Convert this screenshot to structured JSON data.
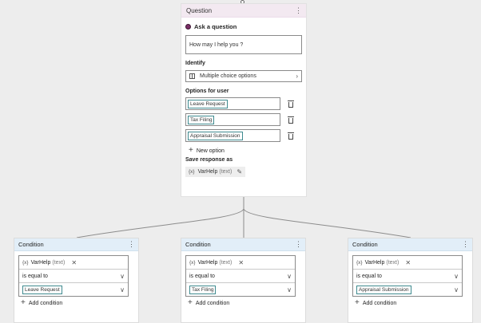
{
  "question": {
    "header_title": "Question",
    "menu_glyph": "⋮",
    "ask_label": "Ask a question",
    "question_text": "How may I help you ?",
    "identify_label": "Identify",
    "identify_value": "Multiple choice options",
    "options_label": "Options for user",
    "options": [
      "Leave Request",
      "Tax Filing",
      "Appraisal Submission"
    ],
    "new_option_label": "New option",
    "save_label": "Save response as",
    "variable": {
      "prefix": "{x}",
      "name": "VarHelp",
      "type": "(text)"
    }
  },
  "conditions": [
    {
      "title": "Condition",
      "variable": {
        "prefix": "{x}",
        "name": "VarHelp",
        "type": "(text)"
      },
      "operator": "is equal to",
      "value": "Leave Request",
      "add_label": "Add condition"
    },
    {
      "title": "Condition",
      "variable": {
        "prefix": "{x}",
        "name": "VarHelp",
        "type": "(text)"
      },
      "operator": "is equal to",
      "value": "Tax Filing",
      "add_label": "Add condition"
    },
    {
      "title": "Condition",
      "variable": {
        "prefix": "{x}",
        "name": "VarHelp",
        "type": "(text)"
      },
      "operator": "is equal to",
      "value": "Appraisal Submission",
      "add_label": "Add condition"
    }
  ],
  "colors": {
    "question_header": "#f3e9f1",
    "condition_header": "#e2eef8",
    "tag_border": "#3f8a8f",
    "canvas": "#ededed"
  },
  "icons": [
    "more-icon",
    "radio-icon",
    "list-icon",
    "chevron-right-icon",
    "delete-icon",
    "add-icon",
    "variable-icon",
    "edit-icon",
    "close-icon",
    "chevron-down-icon"
  ]
}
